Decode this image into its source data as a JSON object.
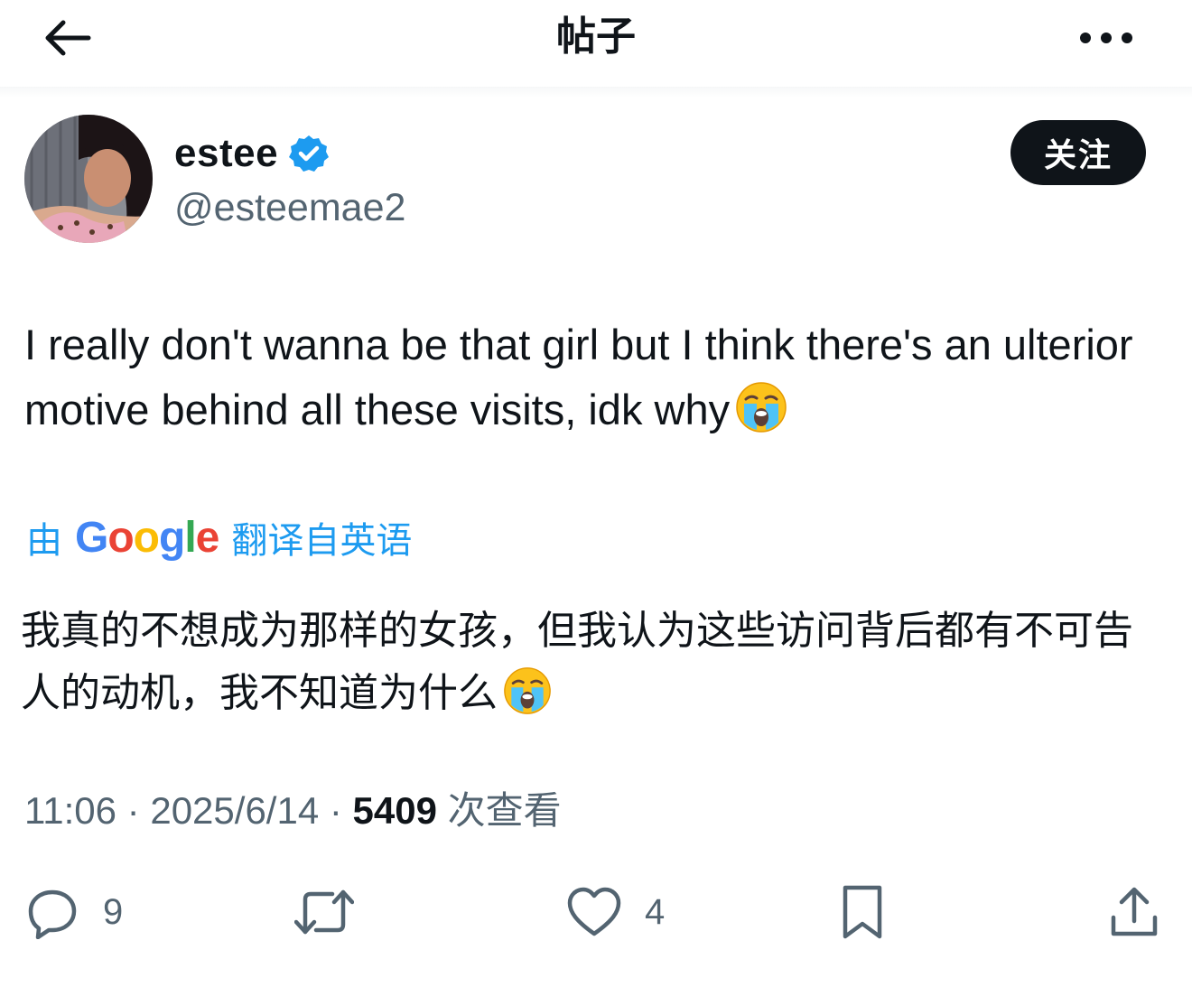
{
  "header": {
    "title": "帖子",
    "back_icon": "arrow-left-icon",
    "more_icon": "more-horizontal-icon"
  },
  "author": {
    "display_name": "estee",
    "handle": "@esteemae2",
    "verified": true,
    "verified_color": "#1d9bf0",
    "follow_label": "关注"
  },
  "tweet": {
    "text": "I really don't wanna be that girl but I think there's an ulterior motive behind all these visits, idk why",
    "emoji_icon": "loudly-crying-face-emoji"
  },
  "translation": {
    "prefix": "由",
    "provider": "Google",
    "suffix": "翻译自英语",
    "text": "我真的不想成为那样的女孩，但我认为这些访问背后都有不可告人的动机，我不知道为什么",
    "link_color": "#1d9bf0"
  },
  "meta": {
    "time": "11:06",
    "separator": "·",
    "date": "2025/6/14",
    "views_count": "5409",
    "views_label": "次查看"
  },
  "actions": {
    "reply_count": "9",
    "retweet_count": "",
    "like_count": "4"
  },
  "colors": {
    "text_primary": "#0f1419",
    "text_secondary": "#536471",
    "accent": "#1d9bf0"
  }
}
